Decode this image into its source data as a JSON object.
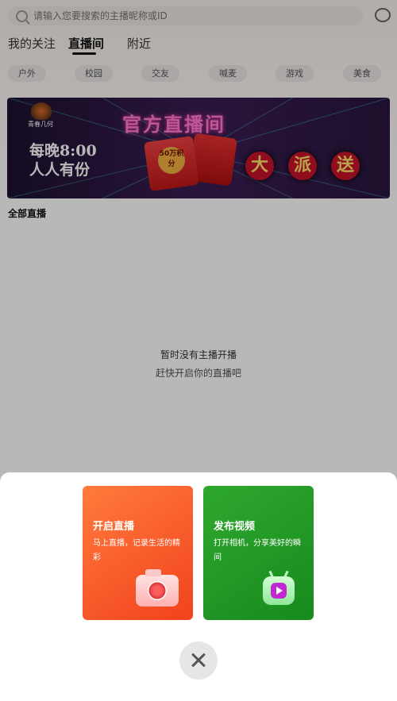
{
  "search": {
    "placeholder": "请输入您要搜索的主播昵称或ID"
  },
  "tabs": [
    {
      "label": "我的关注"
    },
    {
      "label": "直播间",
      "active": true
    },
    {
      "label": "附近"
    }
  ],
  "categories": [
    "户外",
    "校园",
    "交友",
    "喊麦",
    "游戏",
    "美食"
  ],
  "banner": {
    "logo_text": "青春几何",
    "title": "官方直播间",
    "time_text": "每晚8:00",
    "slogan": "人人有份",
    "envelope_label": "50万积分",
    "giveaway_chars": [
      "大",
      "派",
      "送"
    ]
  },
  "section_title": "全部直播",
  "empty_state": {
    "title": "暂时没有主播开播",
    "subtitle": "赶快开启你的直播吧"
  },
  "sheet": {
    "cards": [
      {
        "title": "开启直播",
        "desc": "马上直播，记录生活的精彩",
        "icon": "camera-icon"
      },
      {
        "title": "发布视频",
        "desc": "打开相机，分享美好的瞬间",
        "icon": "tv-play-icon"
      }
    ],
    "close_icon": "close-icon"
  },
  "colors": {
    "live_card": "#f2421c",
    "video_card": "#178a1e",
    "overlay": "rgba(0,0,0,0.28)"
  }
}
